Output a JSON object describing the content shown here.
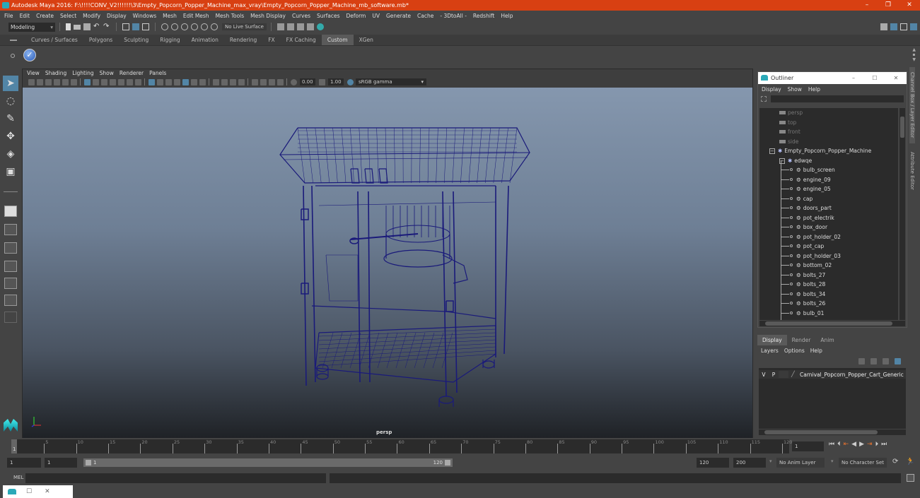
{
  "window": {
    "title": "Autodesk Maya 2016: F:\\!!!!CONV_V2!!!!!!\\3\\Empty_Popcorn_Popper_Machine_max_vray\\Empty_Popcorn_Popper_Machine_mb_software.mb*",
    "controls": [
      "–",
      "❐",
      "✕"
    ]
  },
  "menubar": [
    "File",
    "Edit",
    "Create",
    "Select",
    "Modify",
    "Display",
    "Windows",
    "Mesh",
    "Edit Mesh",
    "Mesh Tools",
    "Mesh Display",
    "Curves",
    "Surfaces",
    "Deform",
    "UV",
    "Generate",
    "Cache",
    "- 3DtoAll -",
    "Redshift",
    "Help"
  ],
  "statusline": {
    "mode": "Modeling",
    "live_surface": "No Live Surface"
  },
  "shelf": {
    "tabs": [
      "Curves / Surfaces",
      "Polygons",
      "Sculpting",
      "Rigging",
      "Animation",
      "Rendering",
      "FX",
      "FX Caching",
      "Custom",
      "XGen"
    ],
    "active_tab": "Custom"
  },
  "viewport": {
    "menu": [
      "View",
      "Shading",
      "Lighting",
      "Show",
      "Renderer",
      "Panels"
    ],
    "exposure": "0.00",
    "gamma": "1.00",
    "color_space": "sRGB gamma",
    "camera_label": "persp",
    "wire_color": "#1a1a7a"
  },
  "outliner": {
    "title": "Outliner",
    "menu": [
      "Display",
      "Show",
      "Help"
    ],
    "cameras": [
      "persp",
      "top",
      "front",
      "side"
    ],
    "root": "Empty_Popcorn_Popper_Machine",
    "group": "edwqe",
    "children": [
      "bulb_screen",
      "engine_09",
      "engine_05",
      "cap",
      "doors_part",
      "pot_electrik",
      "box_door",
      "pot_holder_02",
      "pot_cap",
      "pot_holder_03",
      "bottom_02",
      "bolts_27",
      "bolts_28",
      "bolts_34",
      "bolts_26",
      "bulb_01"
    ]
  },
  "layer_editor": {
    "tabs": [
      "Display",
      "Render",
      "Anim"
    ],
    "active_tab": "Display",
    "menu": [
      "Layers",
      "Options",
      "Help"
    ],
    "layers": [
      {
        "v": "V",
        "p": "P",
        "name": "Carnival_Popcorn_Popper_Cart_Generic"
      }
    ]
  },
  "side_tabs": [
    "Channel Box / Layer Editor",
    "Attribute Editor"
  ],
  "timeline": {
    "ticks": [
      5,
      10,
      15,
      20,
      25,
      30,
      35,
      40,
      45,
      50,
      55,
      60,
      65,
      70,
      75,
      80,
      85,
      90,
      95,
      100,
      105,
      110,
      115,
      120
    ],
    "current_frame": "1",
    "current_field": "1"
  },
  "range": {
    "start": "1",
    "playback_start": "1",
    "slider_start": "1",
    "slider_end": "120",
    "playback_end": "120",
    "end": "200",
    "anim_layer": "No Anim Layer",
    "character_set": "No Character Set"
  },
  "command_line": {
    "label": "MEL"
  },
  "colors": {
    "titlebar": "#d84012",
    "accent": "#5285a6"
  }
}
